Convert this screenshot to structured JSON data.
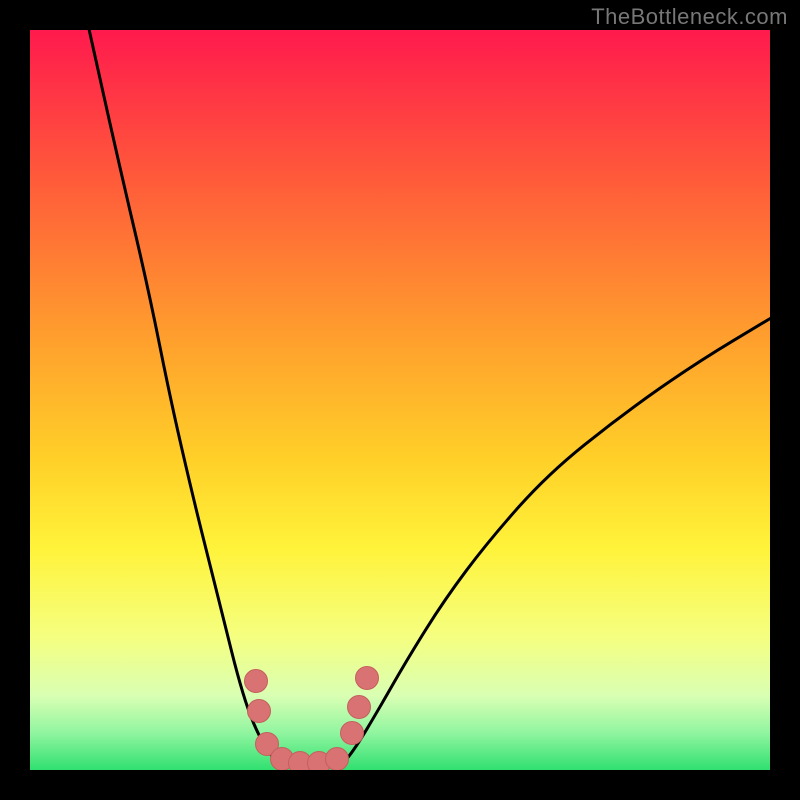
{
  "watermark": {
    "text": "TheBottleneck.com"
  },
  "chart_data": {
    "type": "line",
    "title": "",
    "xlabel": "",
    "ylabel": "",
    "xlim": [
      0,
      100
    ],
    "ylim": [
      0,
      100
    ],
    "grid": false,
    "legend": false,
    "background_gradient": {
      "direction": "vertical",
      "stops": [
        {
          "pos": 0.0,
          "color": "#ff1a4d"
        },
        {
          "pos": 0.2,
          "color": "#ff5a3a"
        },
        {
          "pos": 0.4,
          "color": "#ff9a2e"
        },
        {
          "pos": 0.58,
          "color": "#ffd028"
        },
        {
          "pos": 0.7,
          "color": "#fff33a"
        },
        {
          "pos": 0.82,
          "color": "#f5ff80"
        },
        {
          "pos": 0.9,
          "color": "#d9ffb3"
        },
        {
          "pos": 0.95,
          "color": "#90f5a0"
        },
        {
          "pos": 1.0,
          "color": "#30e070"
        }
      ]
    },
    "series": [
      {
        "name": "left-curve",
        "x": [
          8.0,
          12.0,
          16.0,
          19.0,
          22.0,
          24.5,
          26.5,
          28.0,
          29.5,
          31.0,
          32.5,
          34.0
        ],
        "y": [
          100.0,
          82.0,
          65.0,
          50.0,
          37.0,
          27.0,
          19.0,
          13.0,
          8.0,
          4.5,
          2.0,
          0.5
        ]
      },
      {
        "name": "right-curve",
        "x": [
          42.0,
          44.0,
          47.0,
          51.0,
          56.0,
          62.0,
          70.0,
          80.0,
          90.0,
          100.0
        ],
        "y": [
          0.5,
          3.0,
          8.0,
          15.0,
          23.0,
          31.0,
          40.0,
          48.0,
          55.0,
          61.0
        ]
      }
    ],
    "markers": {
      "name": "bottleneck-zone",
      "color": "#d97373",
      "points": [
        {
          "x": 30.5,
          "y": 12.0
        },
        {
          "x": 31.0,
          "y": 8.0
        },
        {
          "x": 32.0,
          "y": 3.5
        },
        {
          "x": 34.0,
          "y": 1.5
        },
        {
          "x": 36.5,
          "y": 1.0
        },
        {
          "x": 39.0,
          "y": 1.0
        },
        {
          "x": 41.5,
          "y": 1.5
        },
        {
          "x": 43.5,
          "y": 5.0
        },
        {
          "x": 44.5,
          "y": 8.5
        },
        {
          "x": 45.5,
          "y": 12.5
        }
      ]
    }
  }
}
